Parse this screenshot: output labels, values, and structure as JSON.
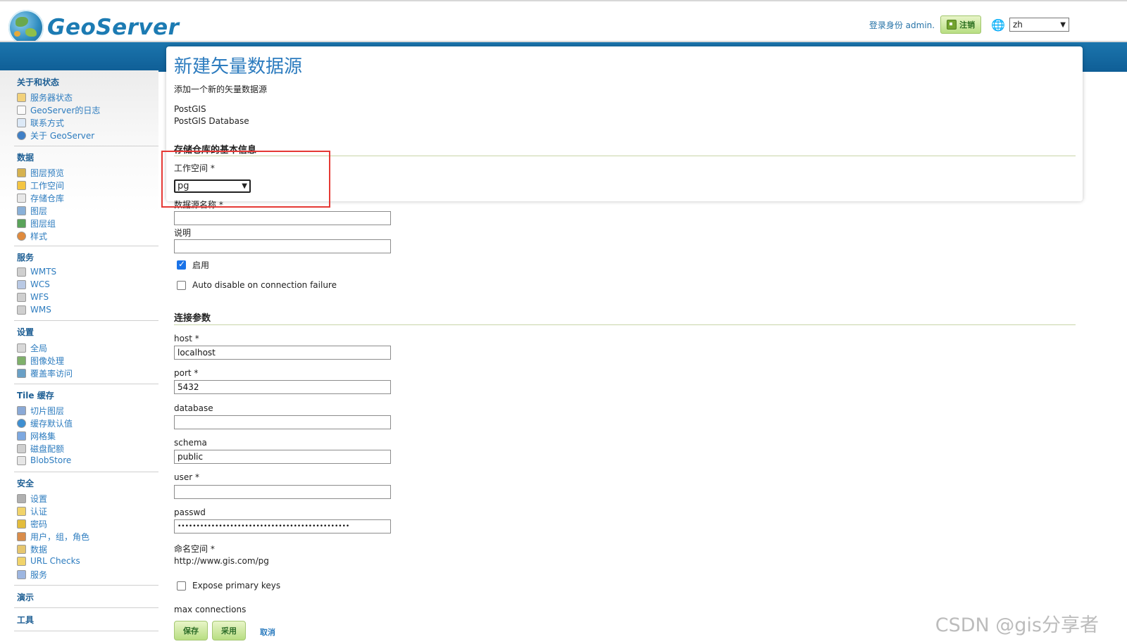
{
  "header": {
    "logo_text": "GeoServer",
    "login_text": "登录身份 admin.",
    "logout_label": "注销",
    "language": "zh"
  },
  "sidebar": {
    "sections": [
      {
        "title": "关于和状态",
        "items": [
          {
            "label": "服务器状态",
            "icon": "server-status-icon"
          },
          {
            "label": "GeoServer的日志",
            "icon": "log-icon"
          },
          {
            "label": "联系方式",
            "icon": "contact-icon"
          },
          {
            "label": "关于 GeoServer",
            "icon": "about-icon"
          }
        ]
      },
      {
        "title": "数据",
        "items": [
          {
            "label": "图层预览",
            "icon": "layer-preview-icon"
          },
          {
            "label": "工作空间",
            "icon": "workspace-icon"
          },
          {
            "label": "存储仓库",
            "icon": "store-icon"
          },
          {
            "label": "图层",
            "icon": "layer-icon"
          },
          {
            "label": "图层组",
            "icon": "layer-group-icon"
          },
          {
            "label": "样式",
            "icon": "style-icon"
          }
        ]
      },
      {
        "title": "服务",
        "items": [
          {
            "label": "WMTS",
            "icon": "wmts-icon"
          },
          {
            "label": "WCS",
            "icon": "wcs-icon"
          },
          {
            "label": "WFS",
            "icon": "wfs-icon"
          },
          {
            "label": "WMS",
            "icon": "wms-icon"
          }
        ]
      },
      {
        "title": "设置",
        "items": [
          {
            "label": "全局",
            "icon": "global-icon"
          },
          {
            "label": "图像处理",
            "icon": "image-processing-icon"
          },
          {
            "label": "覆盖率访问",
            "icon": "coverage-access-icon"
          }
        ]
      },
      {
        "title": "Tile 缓存",
        "items": [
          {
            "label": "切片图层",
            "icon": "tile-layer-icon"
          },
          {
            "label": "缓存默认值",
            "icon": "cache-default-icon"
          },
          {
            "label": "网格集",
            "icon": "gridset-icon"
          },
          {
            "label": "磁盘配额",
            "icon": "disk-quota-icon"
          },
          {
            "label": "BlobStore",
            "icon": "blobstore-icon"
          }
        ]
      },
      {
        "title": "安全",
        "items": [
          {
            "label": "设置",
            "icon": "security-settings-icon"
          },
          {
            "label": "认证",
            "icon": "auth-icon"
          },
          {
            "label": "密码",
            "icon": "password-icon"
          },
          {
            "label": "用户，组，角色",
            "icon": "users-groups-roles-icon"
          },
          {
            "label": "数据",
            "icon": "data-security-icon"
          },
          {
            "label": "URL Checks",
            "icon": "url-checks-icon"
          },
          {
            "label": "服务",
            "icon": "service-security-icon"
          }
        ]
      },
      {
        "title": "演示",
        "items": []
      },
      {
        "title": "工具",
        "items": []
      }
    ]
  },
  "page": {
    "title": "新建矢量数据源",
    "subtitle": "添加一个新的矢量数据源",
    "type_name": "PostGIS",
    "type_desc": "PostGIS Database",
    "basic_info_heading": "存储仓库的基本信息",
    "workspace_label": "工作空间 *",
    "workspace_value": "pg",
    "datasource_label": "数据源名称 *",
    "datasource_value": "",
    "description_label": "说明",
    "description_value": "",
    "enabled_label": "启用",
    "auto_disable_label": "Auto disable on connection failure",
    "conn_heading": "连接参数",
    "host_label": "host *",
    "host_value": "localhost",
    "port_label": "port *",
    "port_value": "5432",
    "database_label": "database",
    "database_value": "",
    "schema_label": "schema",
    "schema_value": "public",
    "user_label": "user *",
    "user_value": "",
    "passwd_label": "passwd",
    "passwd_value": "••••••••••••••••••••••••••••••••••••••••••••••",
    "namespace_label": "命名空间 *",
    "namespace_value": "http://www.gis.com/pg",
    "expose_pk_label": "Expose primary keys",
    "max_conn_label": "max connections",
    "save_label": "保存",
    "apply_label": "采用",
    "cancel_label": "取消"
  },
  "watermark": "CSDN @gis分享者"
}
